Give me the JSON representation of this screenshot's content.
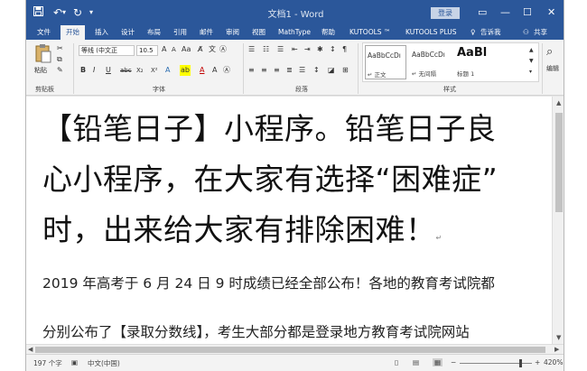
{
  "titlebar": {
    "title": "文档1 - Word",
    "signin_label": "登录",
    "restore_glyph": "▭",
    "minimize_glyph": "—",
    "maximize_glyph": "☐",
    "close_glyph": "✕"
  },
  "quick_access": {
    "save_icon": "save-icon",
    "undo_glyph": "↶",
    "redo_glyph": "↻",
    "customize_glyph": "▾"
  },
  "tabs": [
    {
      "label": "文件"
    },
    {
      "label": "开始",
      "active": true
    },
    {
      "label": "插入"
    },
    {
      "label": "设计"
    },
    {
      "label": "布局"
    },
    {
      "label": "引用"
    },
    {
      "label": "邮件"
    },
    {
      "label": "审阅"
    },
    {
      "label": "视图"
    },
    {
      "label": "MathType"
    },
    {
      "label": "帮助"
    },
    {
      "label": "KUTOOLS ™"
    },
    {
      "label": "KUTOOLS PLUS"
    }
  ],
  "tell_me": "告诉我",
  "share_label": "共享",
  "ribbon": {
    "paste_label": "粘贴",
    "clipboard_group": "剪贴板",
    "font_name": "等线 (中文正",
    "font_size": "10.5",
    "font_group": "字体",
    "paragraph_group": "段落",
    "styles_group": "样式",
    "editing_label": "编辑",
    "font_buttons": {
      "bold": "B",
      "italic": "I",
      "underline": "U",
      "strike": "abc",
      "sub": "X₂",
      "sup": "X²"
    },
    "styles": [
      {
        "sample": "AaBbCcDı",
        "name": "↵ 正文"
      },
      {
        "sample": "AaBbCcDı",
        "name": "↵ 无间隔"
      },
      {
        "sample": "AaBl",
        "name": "标题 1"
      }
    ]
  },
  "document": {
    "heading_line1": "【铅笔日子】小程序。铅笔日子良",
    "heading_line2": "心小程序，在大家有选择“困难症”",
    "heading_line3": "时，出来给大家有排除困难！",
    "para_mark": "↵",
    "para_line1": "2019 年高考于 6 月 24 日 9 时成绩已经全部公布！各地的教育考试院都",
    "para_line2": "分别公布了【录取分数线】，考生大部分都是登录地方教育考试院网站"
  },
  "status": {
    "word_count": "197 个字",
    "language": "中文(中国)",
    "zoom": "420%"
  },
  "colors": {
    "title_bar": "#2b579a",
    "ribbon_bg": "#f3f3f3"
  }
}
